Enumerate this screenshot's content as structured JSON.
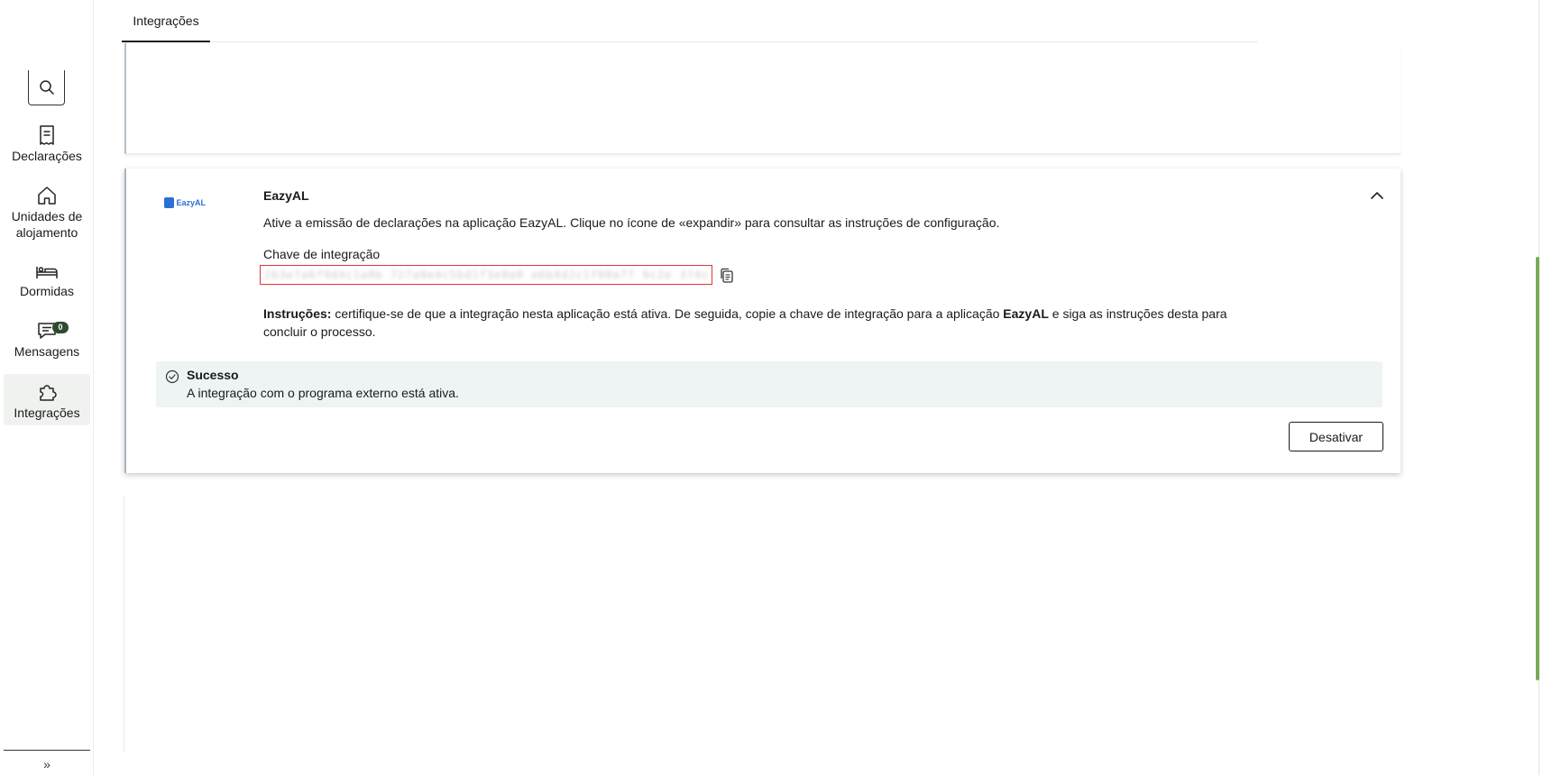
{
  "sidebar": {
    "items": [
      {
        "label": "Declarações",
        "icon": "receipt-icon"
      },
      {
        "label": "Unidades de alojamento",
        "icon": "home-icon"
      },
      {
        "label": "Dormidas",
        "icon": "bed-icon"
      },
      {
        "label": "Mensagens",
        "icon": "message-icon",
        "badge": "0"
      },
      {
        "label": "Integrações",
        "icon": "puzzle-icon",
        "active": true
      }
    ],
    "expand_label": "»"
  },
  "tabs": [
    {
      "label": "Integrações",
      "active": true
    }
  ],
  "integration": {
    "logo_text": "EazyAL",
    "title": "EazyAL",
    "description": "Ative a emissão de declarações na aplicação EazyAL. Clique no ícone de «expandir» para consultar as instruções de configuração.",
    "key_label": "Chave de integração",
    "key_value": "2b3e7a6f9d4c1a8b 727a9e4c5bd1f3e8a0 e6b4d2c1f08a77 9c2e 374c 3be5d4b7",
    "instructions_bold": "Instruções:",
    "instructions_part1": " certifique-se de que a integração nesta aplicação está ativa. De seguida, copie a chave de integração para a aplicação ",
    "instructions_app": "EazyAL",
    "instructions_part2": " e siga as instruções desta para concluir o processo.",
    "alert_title": "Sucesso",
    "alert_text": "A integração com o programa externo está ativa.",
    "deactivate_label": "Desativar"
  },
  "colors": {
    "accent_green": "#7aaa57",
    "badge": "#2f4a2f",
    "alert_bg": "#eef4f4",
    "key_border": "#e03535",
    "logo_blue": "#2b6fd6"
  }
}
